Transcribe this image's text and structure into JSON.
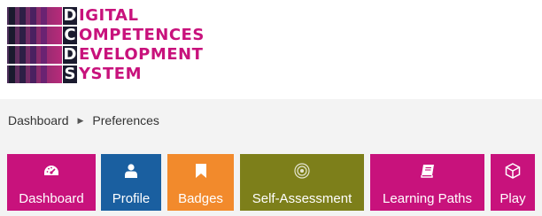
{
  "logo": {
    "rows": [
      {
        "letter": "D",
        "rest": "IGITAL"
      },
      {
        "letter": "C",
        "rest": "OMPETENCES"
      },
      {
        "letter": "D",
        "rest": "EVELOPMENT"
      },
      {
        "letter": "S",
        "rest": "YSTEM"
      }
    ],
    "colors": {
      "accent": "#c8127c",
      "dark": "#1a1a2e",
      "bar": "#7a2a86"
    }
  },
  "breadcrumb": {
    "items": [
      "Dashboard",
      "Preferences"
    ],
    "separator": "▶"
  },
  "nav": {
    "dashboard": {
      "label": "Dashboard",
      "icon": "speedometer-icon",
      "color": "#c8127c"
    },
    "profile": {
      "label": "Profile",
      "icon": "user-icon",
      "color": "#1a5fa0"
    },
    "badges": {
      "label": "Badges",
      "icon": "bookmark-icon",
      "color": "#f28a2c"
    },
    "self_assessment": {
      "label": "Self-Assessment",
      "icon": "target-icon",
      "color": "#7d7f1a"
    },
    "learning_paths": {
      "label": "Learning Paths",
      "icon": "book-icon",
      "color": "#c8127c"
    },
    "play": {
      "label": "Play",
      "icon": "box-icon",
      "color": "#c8127c"
    }
  }
}
